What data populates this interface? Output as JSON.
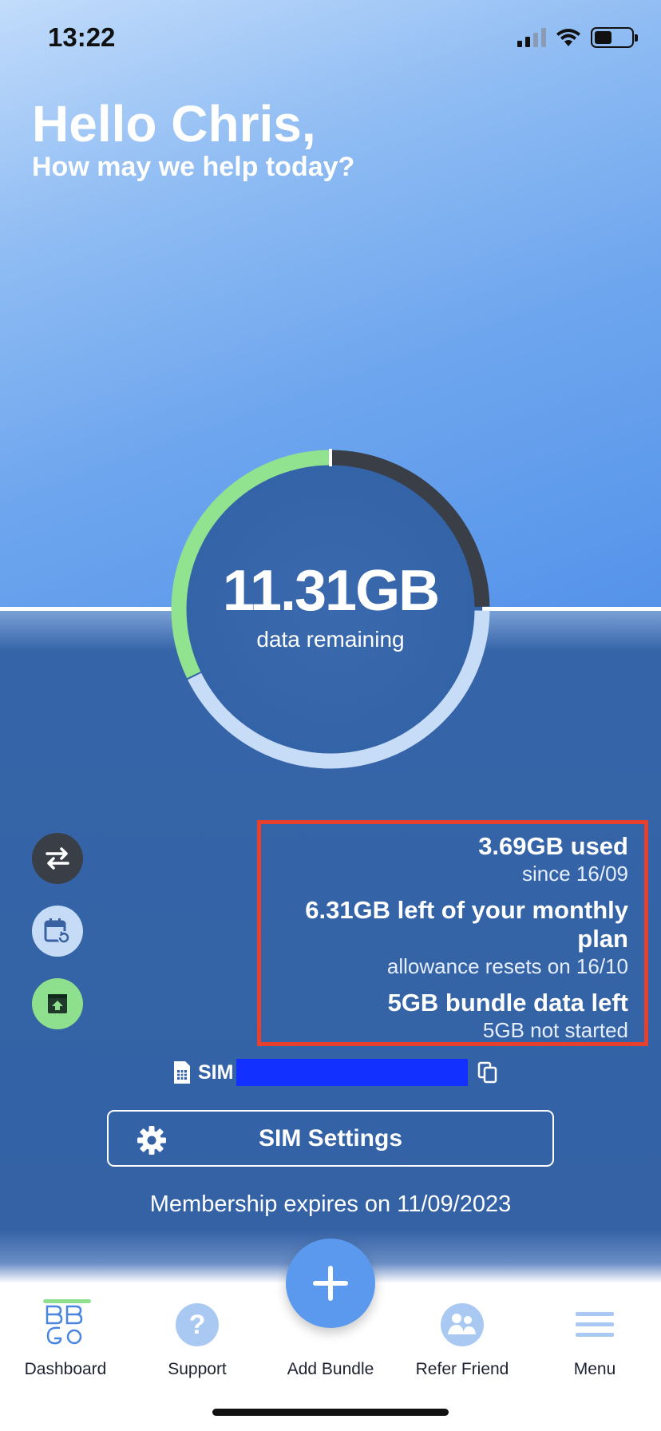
{
  "status_bar": {
    "time": "13:22"
  },
  "header": {
    "greeting": "Hello Chris,",
    "subtitle": "How may we help today?"
  },
  "usage_ring": {
    "value": "11.31GB",
    "label": "data remaining",
    "colors": {
      "bundle": "#92e38f",
      "used": "#3a3f47",
      "plan": "#c7dcf7"
    }
  },
  "stats": [
    {
      "main": "3.69GB used",
      "sub": "since 16/09"
    },
    {
      "main": "6.31GB left of your monthly plan",
      "sub": "allowance resets on 16/10"
    },
    {
      "main": "5GB bundle data left",
      "sub": "5GB not started"
    }
  ],
  "sim": {
    "label": "SIM"
  },
  "sim_settings": {
    "label": "SIM Settings"
  },
  "membership": "Membership expires on 11/09/2023",
  "nav": {
    "items": [
      {
        "label": "Dashboard",
        "icon": "bbgo-logo-icon"
      },
      {
        "label": "Support",
        "icon": "question-icon"
      },
      {
        "label": "Add Bundle",
        "icon": "plus-icon"
      },
      {
        "label": "Refer Friend",
        "icon": "people-icon"
      },
      {
        "label": "Menu",
        "icon": "hamburger-icon"
      }
    ]
  }
}
